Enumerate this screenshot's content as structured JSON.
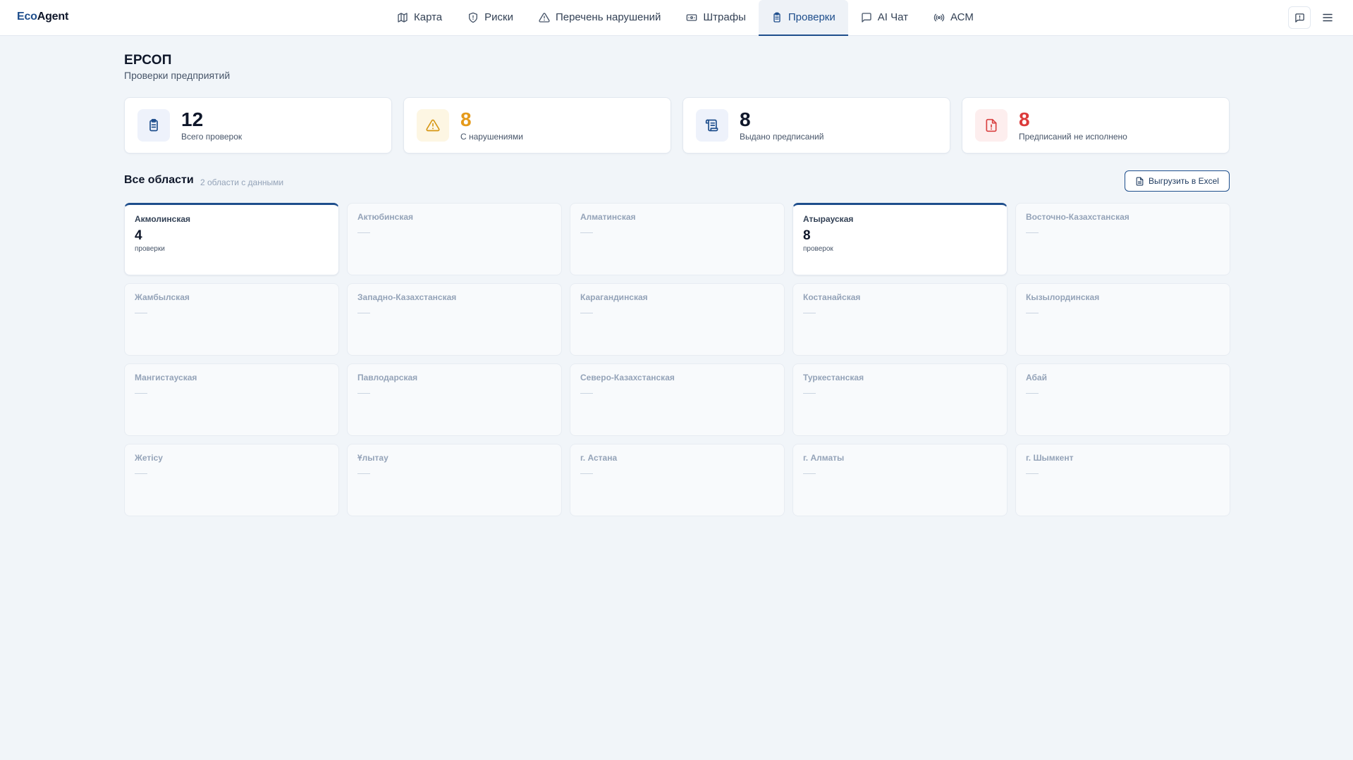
{
  "app": {
    "logo_prefix": "Eco",
    "logo_suffix": "Agent"
  },
  "nav": {
    "items": [
      {
        "label": "Карта",
        "icon": "map-icon"
      },
      {
        "label": "Риски",
        "icon": "shield-icon"
      },
      {
        "label": "Перечень нарушений",
        "icon": "warning-icon"
      },
      {
        "label": "Штрафы",
        "icon": "banknote-icon"
      },
      {
        "label": "Проверки",
        "icon": "clipboard-icon",
        "active": true
      },
      {
        "label": "AI Чат",
        "icon": "chat-icon"
      },
      {
        "label": "АСМ",
        "icon": "radio-icon"
      }
    ]
  },
  "header": {
    "title": "ЕРСОП",
    "subtitle": "Проверки предприятий"
  },
  "stats": [
    {
      "value": "12",
      "label": "Всего проверок",
      "color": "#0f172a",
      "icon_bg": "#eef2fb",
      "icon_color": "#1e4e8c"
    },
    {
      "value": "8",
      "label": "С нарушениями",
      "color": "#e59a1a",
      "icon_bg": "#fdf6e3",
      "icon_color": "#d69613"
    },
    {
      "value": "8",
      "label": "Выдано предписаний",
      "color": "#0f172a",
      "icon_bg": "#eef2fb",
      "icon_color": "#1e4e8c"
    },
    {
      "value": "8",
      "label": "Предписаний не исполнено",
      "color": "#dc3b3b",
      "icon_bg": "#fdeeee",
      "icon_color": "#d94242"
    }
  ],
  "section": {
    "title": "Все области",
    "subtitle": "2 области с данными",
    "export_label": "Выгрузить в Excel"
  },
  "regions": [
    {
      "name": "Акмолинская",
      "count": "4",
      "unit": "проверки"
    },
    {
      "name": "Актюбинская"
    },
    {
      "name": "Алматинская"
    },
    {
      "name": "Атырауская",
      "count": "8",
      "unit": "проверок"
    },
    {
      "name": "Восточно-Казахстанская"
    },
    {
      "name": "Жамбылская"
    },
    {
      "name": "Западно-Казахстанская"
    },
    {
      "name": "Карагандинская"
    },
    {
      "name": "Костанайская"
    },
    {
      "name": "Кызылординская"
    },
    {
      "name": "Мангистауская"
    },
    {
      "name": "Павлодарская"
    },
    {
      "name": "Северо-Казахстанская"
    },
    {
      "name": "Туркестанская"
    },
    {
      "name": "Абай"
    },
    {
      "name": "Жетісу"
    },
    {
      "name": "Ұлытау"
    },
    {
      "name": "г. Астана"
    },
    {
      "name": "г. Алматы"
    },
    {
      "name": "г. Шымкент"
    }
  ]
}
